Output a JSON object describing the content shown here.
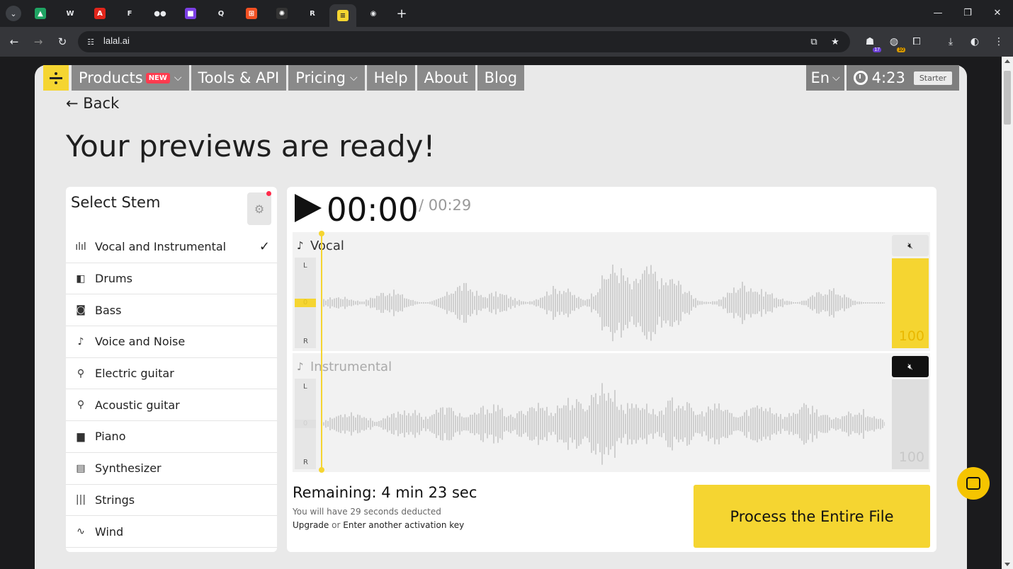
{
  "browser": {
    "url": "lalal.ai",
    "tabs": [
      {
        "name": "tab-drive",
        "color": "#1fa463",
        "glyph": "▲"
      },
      {
        "name": "tab-wikipedia",
        "color": "#ffffff",
        "glyph": "W"
      },
      {
        "name": "tab-adobe",
        "color": "#e1251b",
        "glyph": "A"
      },
      {
        "name": "tab-framer",
        "color": "#ffffff",
        "glyph": "F"
      },
      {
        "name": "tab-medium",
        "color": "#ffffff",
        "glyph": "●●"
      },
      {
        "name": "tab-app-purple",
        "color": "#7b3fe4",
        "glyph": "■"
      },
      {
        "name": "tab-search-app",
        "color": "#ffffff",
        "glyph": "Q"
      },
      {
        "name": "tab-microsoft",
        "color": "#f25022",
        "glyph": "⊞"
      },
      {
        "name": "tab-dark-app",
        "color": "#333333",
        "glyph": "✺"
      },
      {
        "name": "tab-r-app",
        "color": "#ffffff",
        "glyph": "R"
      },
      {
        "name": "tab-lalal",
        "color": "#f5d531",
        "glyph": "≡"
      },
      {
        "name": "tab-github",
        "color": "#ffffff",
        "glyph": "◉"
      }
    ],
    "extensions": {
      "badge_1": "17",
      "badge_2": "10"
    }
  },
  "site_nav": {
    "items": [
      {
        "label": "Products",
        "badge": "NEW",
        "has_chevron": true
      },
      {
        "label": "Tools & API",
        "has_chevron": false
      },
      {
        "label": "Pricing",
        "has_chevron": true
      },
      {
        "label": "Help",
        "has_chevron": false
      },
      {
        "label": "About",
        "has_chevron": false
      },
      {
        "label": "Blog",
        "has_chevron": false
      }
    ],
    "language": "En",
    "timer": "4:23",
    "plan": "Starter"
  },
  "page": {
    "back": "← Back",
    "title": "Your previews are ready!"
  },
  "stems": {
    "heading": "Select Stem",
    "items": [
      {
        "label": "Vocal and Instrumental",
        "icon": "waveform-icon",
        "glyph": "ılıl",
        "selected": true
      },
      {
        "label": "Drums",
        "icon": "drum-icon",
        "glyph": "◧",
        "selected": false
      },
      {
        "label": "Bass",
        "icon": "amp-icon",
        "glyph": "◙",
        "selected": false
      },
      {
        "label": "Voice and Noise",
        "icon": "microphone-icon",
        "glyph": "♪",
        "selected": false
      },
      {
        "label": "Electric guitar",
        "icon": "electric-guitar-icon",
        "glyph": "⚲",
        "selected": false
      },
      {
        "label": "Acoustic guitar",
        "icon": "acoustic-guitar-icon",
        "glyph": "⚲",
        "selected": false
      },
      {
        "label": "Piano",
        "icon": "piano-icon",
        "glyph": "▆",
        "selected": false
      },
      {
        "label": "Synthesizer",
        "icon": "synthesizer-icon",
        "glyph": "▤",
        "selected": false
      },
      {
        "label": "Strings",
        "icon": "strings-icon",
        "glyph": "|||",
        "selected": false
      },
      {
        "label": "Wind",
        "icon": "wind-icon",
        "glyph": "∿",
        "selected": false
      }
    ]
  },
  "player": {
    "current_time": "00:00",
    "total_time": "/ 00:29",
    "tracks": [
      {
        "name": "Vocal",
        "volume": "100",
        "muted": false,
        "L": "L",
        "R": "R",
        "zero": "0"
      },
      {
        "name": "Instrumental",
        "volume": "100",
        "muted": true,
        "L": "L",
        "R": "R",
        "zero": "0"
      }
    ],
    "remaining": "Remaining: 4 min 23 sec",
    "deduct_note": "You will have 29 seconds deducted",
    "upgrade_label": "Upgrade",
    "or_label": "or",
    "activation_label": "Enter another activation key",
    "process_button": "Process the Entire File"
  },
  "colors": {
    "accent": "#f5d531",
    "badge_red": "#ff3b4f",
    "wave_gray": "#cfcfcf"
  }
}
